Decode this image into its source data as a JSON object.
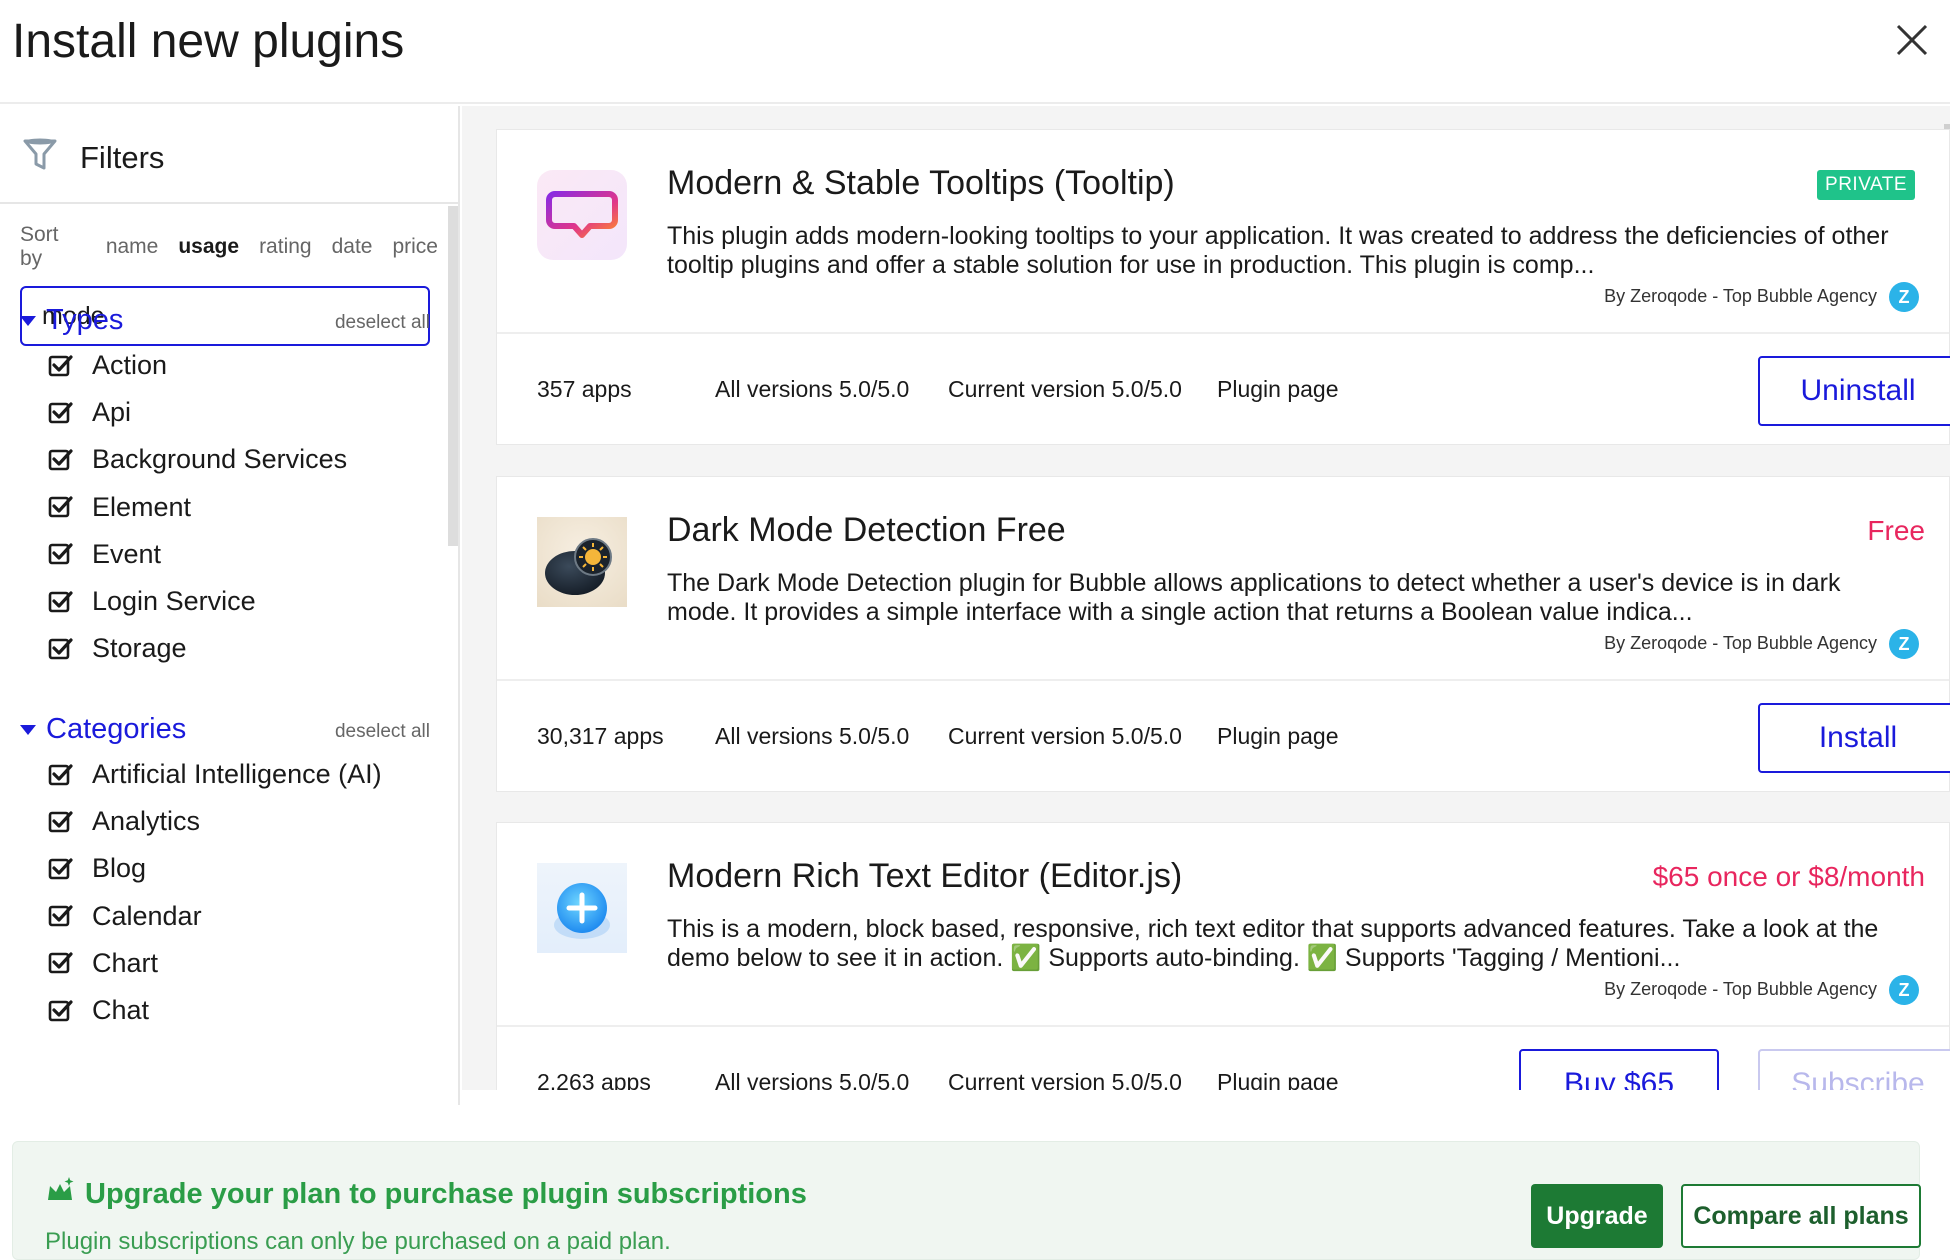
{
  "header": {
    "title": "Install new plugins"
  },
  "filters": {
    "title": "Filters",
    "sort_label": "Sort by",
    "sort_options": [
      "name",
      "usage",
      "rating",
      "date",
      "price"
    ],
    "active_sort": "usage",
    "search_value": "mode",
    "types": {
      "title": "Types",
      "deselect": "deselect all",
      "items": [
        "Action",
        "Api",
        "Background Services",
        "Element",
        "Event",
        "Login Service",
        "Storage"
      ]
    },
    "categories": {
      "title": "Categories",
      "deselect": "deselect all",
      "items": [
        "Artificial Intelligence (AI)",
        "Analytics",
        "Blog",
        "Calendar",
        "Chart",
        "Chat"
      ]
    }
  },
  "plugins": [
    {
      "name": "Modern & Stable Tooltips (Tooltip)",
      "price": "PRIVATE",
      "description": "This plugin adds modern-looking tooltips to your application. It was created to address the deficiencies of other tooltip plugins and offer a stable solution for use in production. This plugin is comp...",
      "author": "By Zeroqode - Top Bubble Agency",
      "apps": "357 apps",
      "all_versions": "All versions 5.0/5.0",
      "current_version": "Current version 5.0/5.0",
      "plugin_page": "Plugin page",
      "action": "Uninstall"
    },
    {
      "name": "Dark Mode Detection Free",
      "price": "Free",
      "description": "The Dark Mode Detection plugin for Bubble allows applications to detect whether a user's device is in dark mode. It provides a simple interface with a single action that returns a Boolean value indica...",
      "author": "By Zeroqode - Top Bubble Agency",
      "apps": "30,317 apps",
      "all_versions": "All versions 5.0/5.0",
      "current_version": "Current version 5.0/5.0",
      "plugin_page": "Plugin page",
      "action": "Install"
    },
    {
      "name": "Modern Rich Text Editor (Editor.js)",
      "price": "$65 once or $8/month",
      "description": "This is a modern, block based, responsive, rich text editor that supports advanced features. Take a look at the demo below to see it in action. ✅ Supports auto-binding. ✅ Supports 'Tagging / Mentioni...",
      "author": "By Zeroqode - Top Bubble Agency",
      "apps": "2,263 apps",
      "all_versions": "All versions 5.0/5.0",
      "current_version": "Current version 5.0/5.0",
      "plugin_page": "Plugin page",
      "action": "Buy $65",
      "action2": "Subscribe"
    }
  ],
  "upgrade": {
    "title": "Upgrade your plan to purchase plugin subscriptions",
    "subtitle": "Plugin subscriptions can only be purchased on a paid plan.",
    "upgrade_label": "Upgrade",
    "compare_label": "Compare all plans"
  },
  "colors": {
    "accent": "#1a1adb",
    "price": "#e8265e",
    "private": "#1fc38a",
    "upgrade": "#1d7a34"
  }
}
